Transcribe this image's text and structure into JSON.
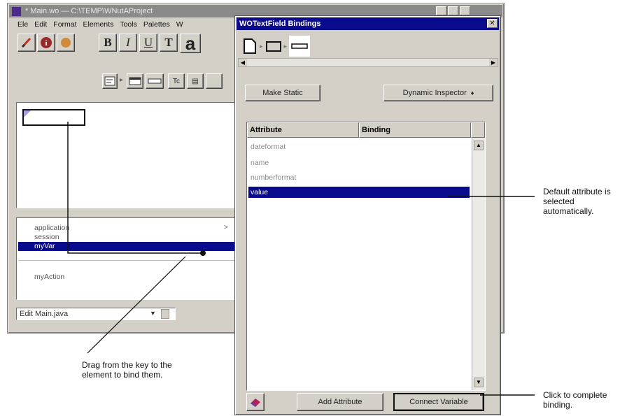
{
  "main_window": {
    "title": "* Main.wo — C:\\TEMP\\WNutAProject",
    "menu": [
      "Ele",
      "Edit",
      "Format",
      "Elements",
      "Tools",
      "Palettes",
      "W"
    ],
    "format_buttons": [
      "B",
      "I",
      "U",
      "T",
      "a"
    ],
    "keys": [
      "application",
      "session",
      "myVar"
    ],
    "action": "myAction",
    "edit_select": "Edit Main.java",
    "tc_label": "Tc"
  },
  "bindings_window": {
    "title": "WOTextField Bindings",
    "make_static_label": "Make Static",
    "dynamic_inspector_label": "Dynamic Inspector",
    "dynamic_inspector_arrow": "♦",
    "columns": [
      "Attribute",
      "Binding"
    ],
    "attributes": [
      "dateformat",
      "name",
      "numberformat",
      "value"
    ],
    "selected_attribute": "value",
    "add_attribute_label": "Add Attribute",
    "connect_variable_label": "Connect Variable"
  },
  "callouts": {
    "default_attribute": "Default attribute is selected automatically.",
    "drag": "Drag from the key to the element to bind them.",
    "click": "Click to complete binding."
  },
  "colors": {
    "titlebar_active": "#0a0a8c",
    "titlebar_inactive": "#8a8a8a",
    "selection": "#0a0a8c",
    "window_bg": "#d4d0c8"
  }
}
